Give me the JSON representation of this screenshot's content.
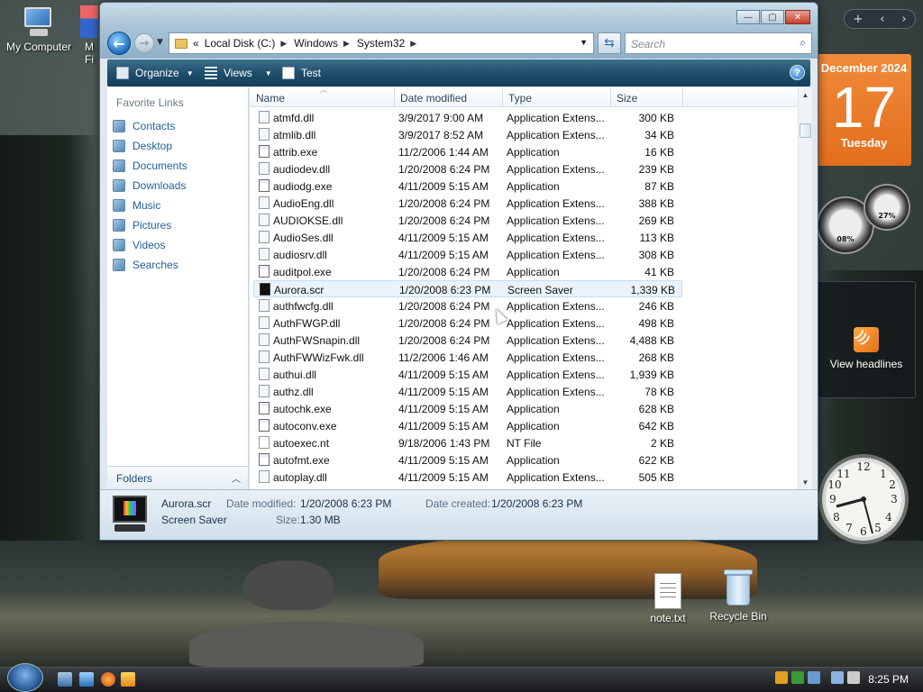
{
  "desktop": {
    "icons": [
      {
        "label": "My Computer",
        "icon": "computer-icon"
      },
      {
        "label": "M",
        "icon": "shortcut-icon"
      },
      {
        "label": "Fi",
        "icon": "shortcut-icon"
      },
      {
        "label": "note.txt",
        "icon": "text-file-icon"
      },
      {
        "label": "Recycle Bin",
        "icon": "recycle-bin-icon"
      }
    ]
  },
  "sidebar": {
    "calendar": {
      "month": "December 2024",
      "day": "17",
      "weekday": "Tuesday"
    },
    "cpu_meter": {
      "cpu": "08%",
      "memory": "27%"
    },
    "feed": {
      "label": "View headlines"
    }
  },
  "window": {
    "caption": {
      "minimize": "—",
      "maximize": "▢",
      "close": "✕"
    },
    "address": {
      "prefix": "«",
      "crumbs": [
        "Local Disk (C:)",
        "Windows",
        "System32"
      ]
    },
    "search_placeholder": "Search",
    "toolbar": {
      "organize": "Organize",
      "views": "Views",
      "test": "Test",
      "help": "?"
    },
    "nav": {
      "favorite_links_title": "Favorite Links",
      "favorites": [
        "Contacts",
        "Desktop",
        "Documents",
        "Downloads",
        "Music",
        "Pictures",
        "Videos",
        "Searches"
      ],
      "folders_label": "Folders"
    },
    "columns": {
      "name": "Name",
      "date": "Date modified",
      "type": "Type",
      "size": "Size"
    },
    "files": [
      {
        "name": "atmfd.dll",
        "date": "3/9/2017 9:00 AM",
        "type": "Application Extens...",
        "size": "300 KB",
        "kind": "dll"
      },
      {
        "name": "atmlib.dll",
        "date": "3/9/2017 8:52 AM",
        "type": "Application Extens...",
        "size": "34 KB",
        "kind": "dll"
      },
      {
        "name": "attrib.exe",
        "date": "11/2/2006 1:44 AM",
        "type": "Application",
        "size": "16 KB",
        "kind": "exe"
      },
      {
        "name": "audiodev.dll",
        "date": "1/20/2008 6:24 PM",
        "type": "Application Extens...",
        "size": "239 KB",
        "kind": "dll"
      },
      {
        "name": "audiodg.exe",
        "date": "4/11/2009 5:15 AM",
        "type": "Application",
        "size": "87 KB",
        "kind": "exe"
      },
      {
        "name": "AudioEng.dll",
        "date": "1/20/2008 6:24 PM",
        "type": "Application Extens...",
        "size": "388 KB",
        "kind": "dll"
      },
      {
        "name": "AUDIOKSE.dll",
        "date": "1/20/2008 6:24 PM",
        "type": "Application Extens...",
        "size": "269 KB",
        "kind": "dll"
      },
      {
        "name": "AudioSes.dll",
        "date": "4/11/2009 5:15 AM",
        "type": "Application Extens...",
        "size": "113 KB",
        "kind": "dll"
      },
      {
        "name": "audiosrv.dll",
        "date": "4/11/2009 5:15 AM",
        "type": "Application Extens...",
        "size": "308 KB",
        "kind": "dll"
      },
      {
        "name": "auditpol.exe",
        "date": "1/20/2008 6:24 PM",
        "type": "Application",
        "size": "41 KB",
        "kind": "exe"
      },
      {
        "name": "Aurora.scr",
        "date": "1/20/2008 6:23 PM",
        "type": "Screen Saver",
        "size": "1,339 KB",
        "kind": "scr",
        "selected": true
      },
      {
        "name": "authfwcfg.dll",
        "date": "1/20/2008 6:24 PM",
        "type": "Application Extens...",
        "size": "246 KB",
        "kind": "dll"
      },
      {
        "name": "AuthFWGP.dll",
        "date": "1/20/2008 6:24 PM",
        "type": "Application Extens...",
        "size": "498 KB",
        "kind": "dll"
      },
      {
        "name": "AuthFWSnapin.dll",
        "date": "1/20/2008 6:24 PM",
        "type": "Application Extens...",
        "size": "4,488 KB",
        "kind": "dll"
      },
      {
        "name": "AuthFWWizFwk.dll",
        "date": "11/2/2006 1:46 AM",
        "type": "Application Extens...",
        "size": "268 KB",
        "kind": "dll"
      },
      {
        "name": "authui.dll",
        "date": "4/11/2009 5:15 AM",
        "type": "Application Extens...",
        "size": "1,939 KB",
        "kind": "dll"
      },
      {
        "name": "authz.dll",
        "date": "4/11/2009 5:15 AM",
        "type": "Application Extens...",
        "size": "78 KB",
        "kind": "dll"
      },
      {
        "name": "autochk.exe",
        "date": "4/11/2009 5:15 AM",
        "type": "Application",
        "size": "628 KB",
        "kind": "exe"
      },
      {
        "name": "autoconv.exe",
        "date": "4/11/2009 5:15 AM",
        "type": "Application",
        "size": "642 KB",
        "kind": "exe"
      },
      {
        "name": "autoexec.nt",
        "date": "9/18/2006 1:43 PM",
        "type": "NT File",
        "size": "2 KB",
        "kind": "txt"
      },
      {
        "name": "autofmt.exe",
        "date": "4/11/2009 5:15 AM",
        "type": "Application",
        "size": "622 KB",
        "kind": "exe"
      },
      {
        "name": "autoplay.dll",
        "date": "4/11/2009 5:15 AM",
        "type": "Application Extens...",
        "size": "505 KB",
        "kind": "dll"
      }
    ],
    "details": {
      "name": "Aurora.scr",
      "type": "Screen Saver",
      "date_modified_label": "Date modified:",
      "date_modified": "1/20/2008 6:23 PM",
      "date_created_label": "Date created:",
      "date_created": "1/20/2008 6:23 PM",
      "size_label": "Size:",
      "size": "1.30 MB"
    }
  },
  "taskbar": {
    "time": "8:25 PM",
    "colors": {
      "accent": "#1f4f6c",
      "calendar": "#e36e1c",
      "link": "#1f5e9e"
    }
  }
}
